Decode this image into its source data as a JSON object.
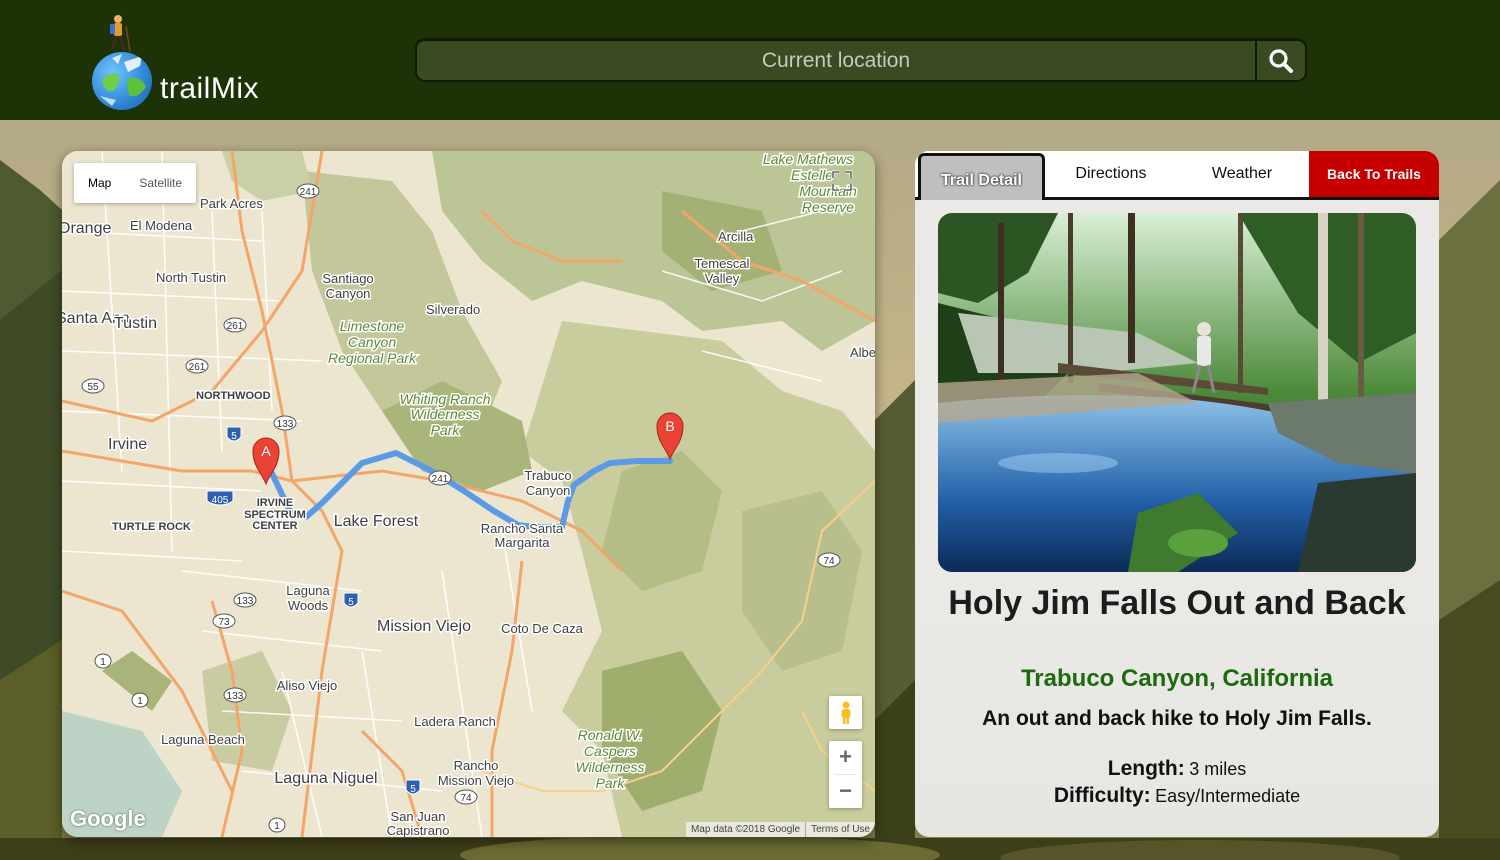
{
  "header": {
    "logo_text": "trailMix",
    "search_placeholder": "Current location"
  },
  "map": {
    "map_type_options": [
      "Map",
      "Satellite"
    ],
    "selected_map_type": "Map",
    "marker_start": "A",
    "marker_end": "B",
    "google_logo": "Google",
    "credits": "Map data ©2018 Google",
    "terms": "Terms of Use",
    "labels": [
      {
        "text": "Lake Mathews",
        "cls": "park"
      },
      {
        "text": "Estelle",
        "cls": "park"
      },
      {
        "text": "Mountain",
        "cls": "park"
      },
      {
        "text": "Reserve",
        "cls": "park"
      },
      {
        "text": "Orange",
        "cls": "bigcity"
      },
      {
        "text": "El Modena",
        "cls": "city"
      },
      {
        "text": "Park Acres",
        "cls": "city"
      },
      {
        "text": "North Tustin",
        "cls": "city"
      },
      {
        "text": "Santiago",
        "cls": "city"
      },
      {
        "text": "Canyon",
        "cls": "city"
      },
      {
        "text": "Silverado",
        "cls": "city"
      },
      {
        "text": "Arcilla",
        "cls": "city"
      },
      {
        "text": "Temescal",
        "cls": "city"
      },
      {
        "text": "Valley",
        "cls": "city"
      },
      {
        "text": "Santa Ana",
        "cls": "bigcity"
      },
      {
        "text": "Tustin",
        "cls": "bigcity"
      },
      {
        "text": "Limestone",
        "cls": "park"
      },
      {
        "text": "Canyon",
        "cls": "park"
      },
      {
        "text": "Regional Park",
        "cls": "park"
      },
      {
        "text": "Alberhill",
        "cls": "city"
      },
      {
        "text": "NORTHWOOD",
        "cls": "district"
      },
      {
        "text": "Whiting Ranch",
        "cls": "park"
      },
      {
        "text": "Wilderness",
        "cls": "park"
      },
      {
        "text": "Park",
        "cls": "park"
      },
      {
        "text": "Irvine",
        "cls": "bigcity"
      },
      {
        "text": "Trabuco",
        "cls": "city"
      },
      {
        "text": "Canyon",
        "cls": "city"
      },
      {
        "text": "IRVINE",
        "cls": "district"
      },
      {
        "text": "SPECTRUM",
        "cls": "district"
      },
      {
        "text": "CENTER",
        "cls": "district"
      },
      {
        "text": "TURTLE ROCK",
        "cls": "district"
      },
      {
        "text": "Lake Forest",
        "cls": "bigcity"
      },
      {
        "text": "Rancho Santa",
        "cls": "city"
      },
      {
        "text": "Margarita",
        "cls": "city"
      },
      {
        "text": "Laguna",
        "cls": "city"
      },
      {
        "text": "Woods",
        "cls": "city"
      },
      {
        "text": "Mission Viejo",
        "cls": "bigcity"
      },
      {
        "text": "Coto De Caza",
        "cls": "city"
      },
      {
        "text": "Aliso Viejo",
        "cls": "city"
      },
      {
        "text": "Ladera Ranch",
        "cls": "city"
      },
      {
        "text": "Ronald W.",
        "cls": "park"
      },
      {
        "text": "Caspers",
        "cls": "park"
      },
      {
        "text": "Wilderness",
        "cls": "park"
      },
      {
        "text": "Park",
        "cls": "park"
      },
      {
        "text": "Laguna Beach",
        "cls": "city"
      },
      {
        "text": "Laguna Niguel",
        "cls": "bigcity"
      },
      {
        "text": "Rancho",
        "cls": "city"
      },
      {
        "text": "Mission Viejo",
        "cls": "city"
      },
      {
        "text": "San Juan",
        "cls": "city"
      },
      {
        "text": "Capistrano",
        "cls": "city"
      }
    ],
    "shields": [
      "241",
      "261",
      "261",
      "55",
      "133",
      "5",
      "405",
      "241",
      "133",
      "73",
      "5",
      "1",
      "1",
      "133",
      "74",
      "5",
      "74",
      "1"
    ]
  },
  "details": {
    "tabs": [
      "Trail Detail",
      "Directions",
      "Weather"
    ],
    "active_tab": "Trail Detail",
    "back_label": "Back To Trails",
    "trail_name": "Holy Jim Falls Out and Back",
    "location": "Trabuco Canyon, California",
    "summary": "An out and back hike to Holy Jim Falls.",
    "length_label": "Length:",
    "length_value": "3 miles",
    "difficulty_label": "Difficulty:",
    "difficulty_value": "Easy/Intermediate"
  },
  "colors": {
    "header_bg": "#1d3207",
    "back_button": "#c60000",
    "location_text": "#1e6a10",
    "route_line": "#5b9be6"
  }
}
